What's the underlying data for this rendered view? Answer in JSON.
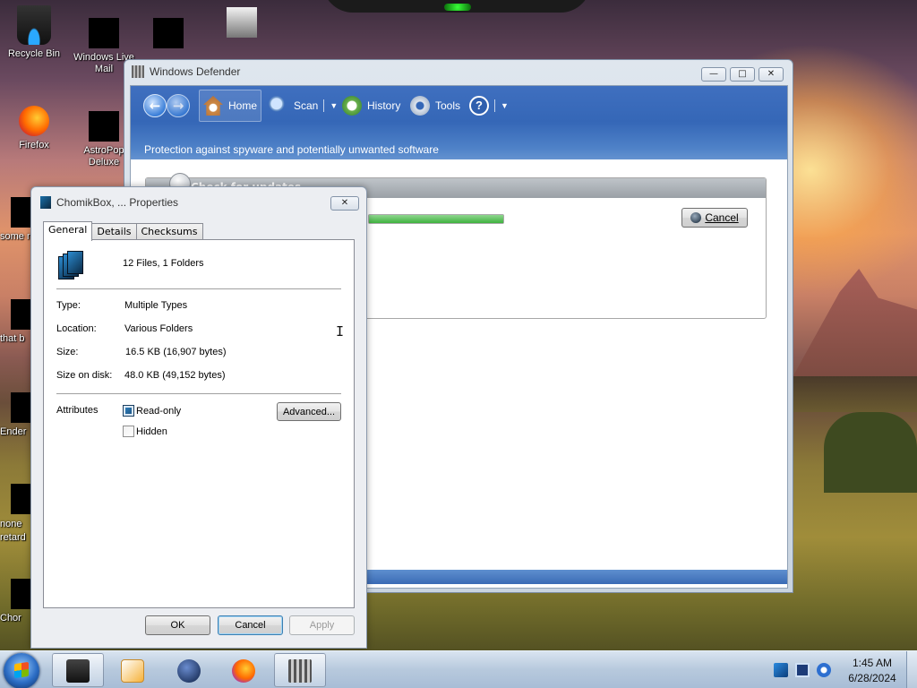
{
  "desktop": {
    "icons": [
      {
        "label": "Recycle Bin"
      },
      {
        "label": "Windows Live Mail"
      },
      {
        "label": ""
      },
      {
        "label": ""
      },
      {
        "label": "Firefox"
      },
      {
        "label": "AstroPop Deluxe"
      },
      {
        "label": "some ran"
      },
      {
        "label": "that b"
      },
      {
        "label": "Ender"
      },
      {
        "label": "none retard"
      },
      {
        "label": "Chor"
      }
    ]
  },
  "defender": {
    "title": "Windows Defender",
    "toolbar": {
      "home": "Home",
      "scan": "Scan",
      "history": "History",
      "tools": "Tools"
    },
    "subtitle": "Protection against spyware and potentially unwanted software",
    "update_title": "Check for updates",
    "update_progress": 100,
    "cancel_label": "Cancel"
  },
  "properties": {
    "title": "ChomikBox, ... Properties",
    "tabs": [
      "General",
      "Details",
      "Checksums"
    ],
    "summary": "12 Files, 1 Folders",
    "fields": [
      {
        "label": "Type:",
        "value": "Multiple Types"
      },
      {
        "label": "Location:",
        "value": "Various Folders"
      },
      {
        "label": "Size:",
        "value": "16.5 KB (16,907 bytes)"
      },
      {
        "label": "Size on disk:",
        "value": "48.0 KB (49,152 bytes)"
      }
    ],
    "attributes_label": "Attributes",
    "readonly_label": "Read-only",
    "readonly_checked": true,
    "hidden_label": "Hidden",
    "hidden_checked": false,
    "advanced_label": "Advanced...",
    "ok_label": "OK",
    "cancel_label": "Cancel",
    "apply_label": "Apply"
  },
  "taskbar": {
    "time": "1:45 AM",
    "date": "6/28/2024"
  },
  "colors": {
    "toolbar_blue": "#3567b7",
    "taskbar": "#b7c9dd"
  }
}
